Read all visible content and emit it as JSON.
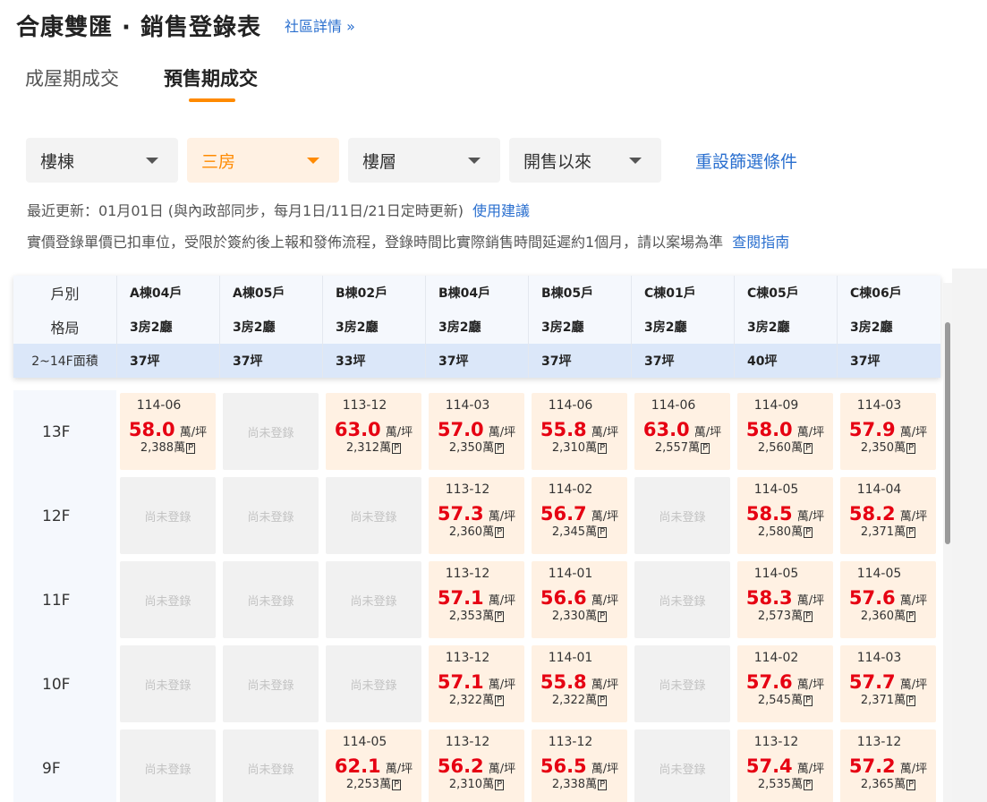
{
  "header": {
    "title": "合康雙匯 · 銷售登錄表",
    "community_link": "社區詳情 »"
  },
  "tabs": [
    {
      "label": "成屋期成交",
      "active": false
    },
    {
      "label": "預售期成交",
      "active": true
    }
  ],
  "filters": {
    "building": "樓棟",
    "rooms": "三房",
    "floor": "樓層",
    "period": "開售以來",
    "reset": "重設篩選條件"
  },
  "info": {
    "update_text": "最近更新：01月01日 (與內政部同步，每月1日/11日/21日定時更新)",
    "suggest_link": "使用建議",
    "notice_text": "實價登錄單價已扣車位，受限於簽約後上報和發佈流程，登錄時間比實際銷售時間延遲約1個月，請以案場為準",
    "guide_link": "查閱指南"
  },
  "table": {
    "row_labels": {
      "unit": "戶別",
      "layout": "格局",
      "area": "2~14F面積"
    },
    "columns": [
      {
        "unit": "A棟04戶",
        "layout": "3房2廳",
        "area": "37坪"
      },
      {
        "unit": "A棟05戶",
        "layout": "3房2廳",
        "area": "37坪"
      },
      {
        "unit": "B棟02戶",
        "layout": "3房2廳",
        "area": "33坪"
      },
      {
        "unit": "B棟04戶",
        "layout": "3房2廳",
        "area": "37坪"
      },
      {
        "unit": "B棟05戶",
        "layout": "3房2廳",
        "area": "37坪"
      },
      {
        "unit": "C棟01戶",
        "layout": "3房2廳",
        "area": "37坪"
      },
      {
        "unit": "C棟05戶",
        "layout": "3房2廳",
        "area": "40坪"
      },
      {
        "unit": "C棟06戶",
        "layout": "3房2廳",
        "area": "37坪"
      }
    ],
    "empty_text": "尚未登錄",
    "price_unit": "萬/坪",
    "total_unit": "萬",
    "parking_mark": "P",
    "floors": [
      {
        "label": "13F",
        "cells": [
          {
            "date": "114-06",
            "price": "58.0",
            "total": "2,388"
          },
          null,
          {
            "date": "113-12",
            "price": "63.0",
            "total": "2,312"
          },
          {
            "date": "114-03",
            "price": "57.0",
            "total": "2,350"
          },
          {
            "date": "114-06",
            "price": "55.8",
            "total": "2,310"
          },
          {
            "date": "114-06",
            "price": "63.0",
            "total": "2,557"
          },
          {
            "date": "114-09",
            "price": "58.0",
            "total": "2,560"
          },
          {
            "date": "114-03",
            "price": "57.9",
            "total": "2,350"
          }
        ]
      },
      {
        "label": "12F",
        "cells": [
          null,
          null,
          null,
          {
            "date": "113-12",
            "price": "57.3",
            "total": "2,360"
          },
          {
            "date": "114-02",
            "price": "56.7",
            "total": "2,345"
          },
          null,
          {
            "date": "114-05",
            "price": "58.5",
            "total": "2,580"
          },
          {
            "date": "114-04",
            "price": "58.2",
            "total": "2,371"
          }
        ]
      },
      {
        "label": "11F",
        "cells": [
          null,
          null,
          null,
          {
            "date": "113-12",
            "price": "57.1",
            "total": "2,353"
          },
          {
            "date": "114-01",
            "price": "56.6",
            "total": "2,330"
          },
          null,
          {
            "date": "114-05",
            "price": "58.3",
            "total": "2,573"
          },
          {
            "date": "114-05",
            "price": "57.6",
            "total": "2,360"
          }
        ]
      },
      {
        "label": "10F",
        "cells": [
          null,
          null,
          null,
          {
            "date": "113-12",
            "price": "57.1",
            "total": "2,322"
          },
          {
            "date": "114-01",
            "price": "55.8",
            "total": "2,322"
          },
          null,
          {
            "date": "114-02",
            "price": "57.6",
            "total": "2,545"
          },
          {
            "date": "114-03",
            "price": "57.7",
            "total": "2,371"
          }
        ]
      },
      {
        "label": "9F",
        "cells": [
          null,
          null,
          {
            "date": "114-05",
            "price": "62.1",
            "total": "2,253"
          },
          {
            "date": "113-12",
            "price": "56.2",
            "total": "2,310"
          },
          {
            "date": "113-12",
            "price": "56.5",
            "total": "2,338"
          },
          null,
          {
            "date": "113-12",
            "price": "57.4",
            "total": "2,535"
          },
          {
            "date": "113-12",
            "price": "57.2",
            "total": "2,365"
          }
        ]
      }
    ]
  }
}
